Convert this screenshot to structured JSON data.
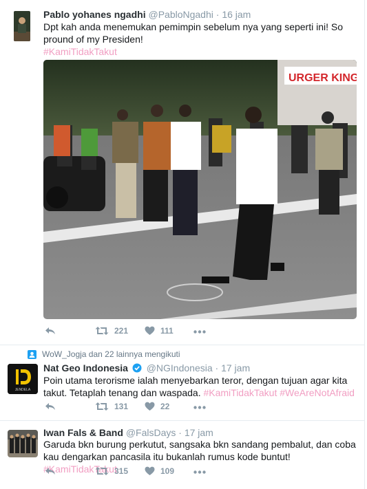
{
  "colors": {
    "hashtag": "#f19ec2",
    "muted": "#8899a6",
    "verified": "#1da1f2"
  },
  "tweets": [
    {
      "name": "Pablo yohanes ngadhi",
      "handle": "@PabloNgadhi",
      "separator": "·",
      "time": "16 jam",
      "text": "Dpt kah anda menemukan pemimpin sebelum nya yang seperti ini! So pround of my Presiden!",
      "hashtags": [
        "#KamiTidakTakut"
      ],
      "photo_sign": "URGER KING",
      "reply_icon": "reply-icon",
      "retweets": "221",
      "likes": "111",
      "more_icon": "more-icon"
    },
    {
      "context": "WoW_Jogja dan 22 lainnya mengikuti",
      "name": "Nat Geo Indonesia",
      "handle": "@NGIndonesia",
      "separator": "·",
      "time": "17 jam",
      "avatar_text": "JENDELA",
      "text": "Poin utama terorisme ialah menyebarkan teror, dengan tujuan agar kita takut. Tetaplah tenang dan waspada.",
      "hashtags": [
        "#KamiTidakTakut",
        "#WeAreNotAfraid"
      ],
      "retweets": "131",
      "likes": "22"
    },
    {
      "name": "Iwan Fals & Band",
      "handle": "@FalsDays",
      "separator": "·",
      "time": "17 jam",
      "text": "Garuda bkn burung perkutut, sangsaka bkn sandang pembalut, dan coba kau dengarkan pancasila itu bukanlah rumus kode buntut!",
      "hashtags": [
        "#KamiTidakTakut"
      ],
      "retweets": "315",
      "likes": "109"
    }
  ]
}
